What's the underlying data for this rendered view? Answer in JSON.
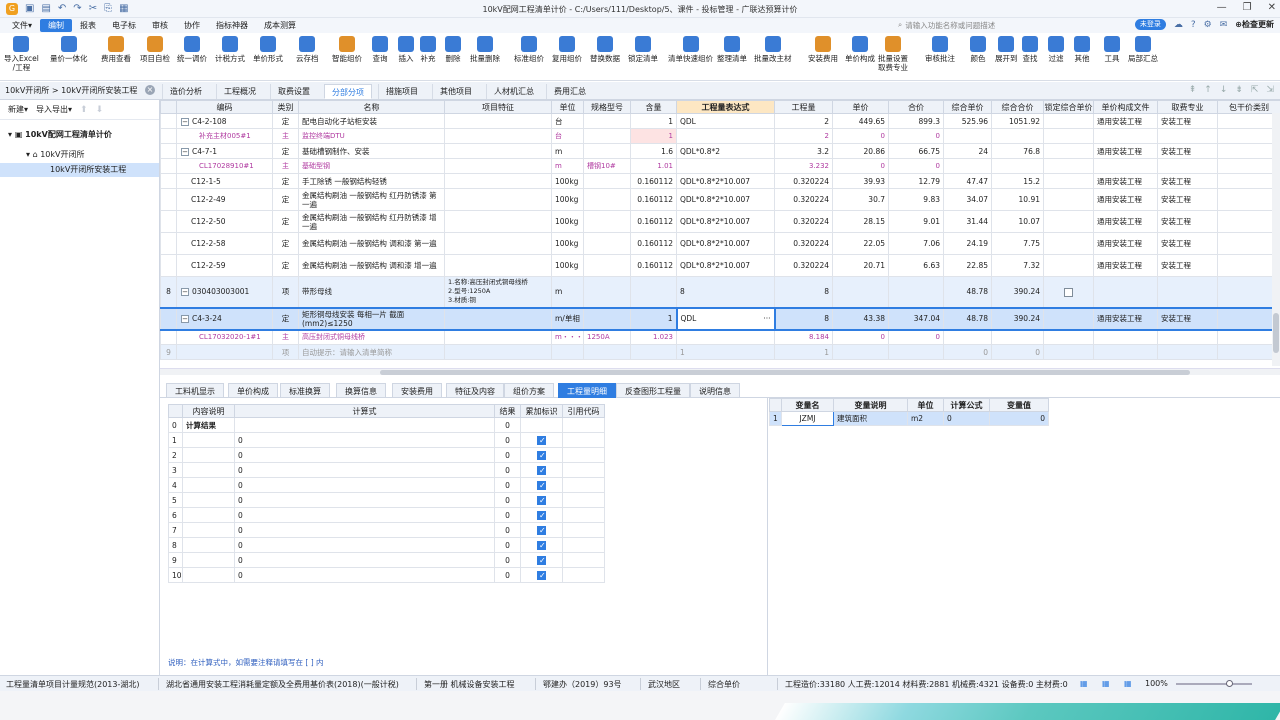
{
  "window": {
    "title": "10kV配网工程清单计价 - C:/Users/111/Desktop/5、课件 - 投标管理 - 广联达预算计价",
    "controls": [
      "—",
      "❐",
      "✕"
    ]
  },
  "menu": {
    "items": [
      "文件▾",
      "编制",
      "报表",
      "电子标",
      "审核",
      "协作",
      "指标神器",
      "成本测算"
    ],
    "active": 1,
    "search_placeholder": "请输入功能名称或问题描述",
    "login": "未登录",
    "update": "检查更新"
  },
  "ribbon": [
    {
      "label": "导入Excel\n/工程",
      "color": "#3a7bd5"
    },
    {
      "label": "量价一体化",
      "color": "#3a7bd5"
    },
    {
      "label": "费用查看",
      "color": "#e0902a"
    },
    {
      "label": "项目自检",
      "color": "#e0902a"
    },
    {
      "label": "统一调价",
      "color": "#3a7bd5"
    },
    {
      "label": "计税方式",
      "color": "#3a7bd5"
    },
    {
      "label": "单价形式",
      "color": "#3a7bd5"
    },
    {
      "label": "云存档",
      "color": "#3a7bd5"
    },
    {
      "label": "智能组价",
      "color": "#e0902a"
    },
    {
      "label": "查询",
      "color": "#3a7bd5"
    },
    {
      "label": "插入",
      "color": "#3a7bd5"
    },
    {
      "label": "补充",
      "color": "#3a7bd5"
    },
    {
      "label": "删除",
      "color": "#3a7bd5"
    },
    {
      "label": "批量删除",
      "color": "#3a7bd5"
    },
    {
      "label": "标准组价",
      "color": "#3a7bd5"
    },
    {
      "label": "复用组价",
      "color": "#3a7bd5"
    },
    {
      "label": "替换数据",
      "color": "#3a7bd5"
    },
    {
      "label": "锁定清单",
      "color": "#3a7bd5"
    },
    {
      "label": "清单快速组价",
      "color": "#3a7bd5"
    },
    {
      "label": "整理清单",
      "color": "#3a7bd5"
    },
    {
      "label": "批量改主材",
      "color": "#3a7bd5"
    },
    {
      "label": "安装费用",
      "color": "#e0902a"
    },
    {
      "label": "单价构成",
      "color": "#3a7bd5"
    },
    {
      "label": "批量设置\n取费专业",
      "color": "#e0902a"
    },
    {
      "label": "审核批注",
      "color": "#3a7bd5"
    },
    {
      "label": "颜色",
      "color": "#3a7bd5"
    },
    {
      "label": "展开到",
      "color": "#3a7bd5"
    },
    {
      "label": "查找",
      "color": "#3a7bd5"
    },
    {
      "label": "过滤",
      "color": "#3a7bd5"
    },
    {
      "label": "其他",
      "color": "#3a7bd5"
    },
    {
      "label": "工具",
      "color": "#3a7bd5"
    },
    {
      "label": "局部汇总",
      "color": "#3a7bd5"
    }
  ],
  "tabs": {
    "breadcrumb": "10kV开闭所 > 10kV开闭所安装工程",
    "items": [
      "造价分析",
      "工程概况",
      "取费设置",
      "分部分项",
      "措施项目",
      "其他项目",
      "人材机汇总",
      "费用汇总"
    ],
    "active": 3
  },
  "tree": {
    "toolbar": [
      "新建▾",
      "导入导出▾"
    ],
    "root": "10kV配网工程清单计价",
    "sub": "10kV开闭所",
    "selected": "10kV开闭所安装工程"
  },
  "grid": {
    "headers": [
      "",
      "编码",
      "类别",
      "名称",
      "项目特征",
      "单位",
      "规格型号",
      "含量",
      "工程量表达式",
      "工程量",
      "单价",
      "合价",
      "综合单价",
      "综合合价",
      "锁定综合单价",
      "单价构成文件",
      "取费专业",
      "包干价类别"
    ],
    "rows": [
      {
        "cls": "",
        "h": "",
        "tog": "−",
        "code": "C4-2-108",
        "type": "定",
        "name": "配电自动化子站柜安装",
        "feat": "",
        "unit": "台",
        "spec": "",
        "cont": "1",
        "expr": "QDL",
        "qty": "2",
        "price": "449.65",
        "total": "899.3",
        "uprice": "525.96",
        "utotal": "1051.92",
        "lock": "",
        "file": "通用安装工程",
        "prof": "安装工程"
      },
      {
        "cls": "mat",
        "h": "",
        "tog": "",
        "code": "补充主材005#1",
        "type": "主",
        "name": "监控终端DTU",
        "feat": "",
        "unit": "台",
        "spec": "",
        "cont": "1",
        "expr": "",
        "qty": "2",
        "price": "0",
        "total": "0",
        "uprice": "",
        "utotal": "",
        "lock": "",
        "file": "",
        "prof": ""
      },
      {
        "cls": "",
        "h": "",
        "tog": "−",
        "code": "C4-7-1",
        "type": "定",
        "name": "基础槽钢制作、安装",
        "feat": "",
        "unit": "m",
        "spec": "",
        "cont": "1.6",
        "expr": "QDL*0.8*2",
        "qty": "3.2",
        "price": "20.86",
        "total": "66.75",
        "uprice": "24",
        "utotal": "76.8",
        "lock": "",
        "file": "通用安装工程",
        "prof": "安装工程"
      },
      {
        "cls": "mat",
        "h": "",
        "tog": "",
        "code": "CL17028910#1",
        "type": "主",
        "name": "基础型钢",
        "feat": "",
        "unit": "m",
        "spec": "槽钢10#",
        "cont": "1.01",
        "expr": "",
        "qty": "3.232",
        "price": "0",
        "total": "0",
        "uprice": "",
        "utotal": "",
        "lock": "",
        "file": "",
        "prof": ""
      },
      {
        "cls": "",
        "h": "",
        "tog": "",
        "code": "C12-1-5",
        "type": "定",
        "name": "手工除锈 一般钢结构轻锈",
        "feat": "",
        "unit": "100kg",
        "spec": "",
        "cont": "0.160112",
        "expr": "QDL*0.8*2*10.007",
        "qty": "0.320224",
        "price": "39.93",
        "total": "12.79",
        "uprice": "47.47",
        "utotal": "15.2",
        "lock": "",
        "file": "通用安装工程",
        "prof": "安装工程"
      },
      {
        "cls": "t2",
        "h": "",
        "tog": "",
        "code": "C12-2-49",
        "type": "定",
        "name": "金属结构刷油 一般钢结构 红丹防锈漆 第一遍",
        "feat": "",
        "unit": "100kg",
        "spec": "",
        "cont": "0.160112",
        "expr": "QDL*0.8*2*10.007",
        "qty": "0.320224",
        "price": "30.7",
        "total": "9.83",
        "uprice": "34.07",
        "utotal": "10.91",
        "lock": "",
        "file": "通用安装工程",
        "prof": "安装工程"
      },
      {
        "cls": "t2",
        "h": "",
        "tog": "",
        "code": "C12-2-50",
        "type": "定",
        "name": "金属结构刷油 一般钢结构 红丹防锈漆 增一遍",
        "feat": "",
        "unit": "100kg",
        "spec": "",
        "cont": "0.160112",
        "expr": "QDL*0.8*2*10.007",
        "qty": "0.320224",
        "price": "28.15",
        "total": "9.01",
        "uprice": "31.44",
        "utotal": "10.07",
        "lock": "",
        "file": "通用安装工程",
        "prof": "安装工程"
      },
      {
        "cls": "t2",
        "h": "",
        "tog": "",
        "code": "C12-2-58",
        "type": "定",
        "name": "金属结构刷油 一般钢结构 调和漆 第一遍",
        "feat": "",
        "unit": "100kg",
        "spec": "",
        "cont": "0.160112",
        "expr": "QDL*0.8*2*10.007",
        "qty": "0.320224",
        "price": "22.05",
        "total": "7.06",
        "uprice": "24.19",
        "utotal": "7.75",
        "lock": "",
        "file": "通用安装工程",
        "prof": "安装工程"
      },
      {
        "cls": "t2",
        "h": "",
        "tog": "",
        "code": "C12-2-59",
        "type": "定",
        "name": "金属结构刷油 一般钢结构 调和漆 增一遍",
        "feat": "",
        "unit": "100kg",
        "spec": "",
        "cont": "0.160112",
        "expr": "QDL*0.8*2*10.007",
        "qty": "0.320224",
        "price": "20.71",
        "total": "6.63",
        "uprice": "22.85",
        "utotal": "7.32",
        "lock": "",
        "file": "通用安装工程",
        "prof": "安装工程"
      },
      {
        "cls": "t3 qd",
        "h": "8",
        "tog": "−",
        "code": "030403003001",
        "type": "项",
        "name": "带形母线",
        "feat": "1.名称:高压封闭式铜母线桥\n2.型号:1250A\n3.材质:铜",
        "unit": "m",
        "spec": "",
        "cont": "",
        "expr": "8",
        "qty": "8",
        "price": "",
        "total": "",
        "uprice": "48.78",
        "utotal": "390.24",
        "lock": "box",
        "file": "",
        "prof": ""
      },
      {
        "cls": "t2 sel",
        "h": "",
        "tog": "−",
        "code": "C4-3-24",
        "type": "定",
        "name": "矩形铜母线安装 每相一片 截面(mm2)≤1250",
        "feat": "",
        "unit": "m/单相",
        "spec": "",
        "cont": "1",
        "expr": "QDL",
        "qty": "8",
        "price": "43.38",
        "total": "347.04",
        "uprice": "48.78",
        "utotal": "390.24",
        "lock": "",
        "file": "通用安装工程",
        "prof": "安装工程"
      },
      {
        "cls": "mat",
        "h": "",
        "tog": "",
        "code": "CL17032020-1#1",
        "type": "主",
        "name": "高压封闭式铜母线桥",
        "feat": "",
        "unit": "m・・・",
        "spec": "1250A",
        "cont": "1.023",
        "expr": "",
        "qty": "8.184",
        "price": "0",
        "total": "0",
        "uprice": "",
        "utotal": "",
        "lock": "",
        "file": "",
        "prof": ""
      },
      {
        "cls": "auto",
        "h": "9",
        "tog": "",
        "code": "",
        "type": "项",
        "name": "自动提示：请输入清单简称",
        "feat": "",
        "unit": "",
        "spec": "",
        "cont": "",
        "expr": "1",
        "qty": "1",
        "price": "",
        "total": "",
        "uprice": "0",
        "utotal": "0",
        "lock": "",
        "file": "",
        "prof": ""
      }
    ]
  },
  "bottom_tabs": {
    "items": [
      "工料机显示",
      "单价构成",
      "标准换算",
      "换算信息",
      "安装费用",
      "特征及内容",
      "组价方案",
      "工程量明细",
      "反查图形工程量",
      "说明信息"
    ],
    "active": 7
  },
  "calc": {
    "headers": [
      "",
      "内容说明",
      "计算式",
      "结果",
      "累加标识",
      "引用代码"
    ],
    "rows": [
      {
        "i": "0",
        "desc": "计算结果",
        "formula": "",
        "result": "0",
        "check": false
      },
      {
        "i": "1",
        "desc": "",
        "formula": "0",
        "result": "0",
        "check": true
      },
      {
        "i": "2",
        "desc": "",
        "formula": "0",
        "result": "0",
        "check": true
      },
      {
        "i": "3",
        "desc": "",
        "formula": "0",
        "result": "0",
        "check": true
      },
      {
        "i": "4",
        "desc": "",
        "formula": "0",
        "result": "0",
        "check": true
      },
      {
        "i": "5",
        "desc": "",
        "formula": "0",
        "result": "0",
        "check": true
      },
      {
        "i": "6",
        "desc": "",
        "formula": "0",
        "result": "0",
        "check": true
      },
      {
        "i": "7",
        "desc": "",
        "formula": "0",
        "result": "0",
        "check": true
      },
      {
        "i": "8",
        "desc": "",
        "formula": "0",
        "result": "0",
        "check": true
      },
      {
        "i": "9",
        "desc": "",
        "formula": "0",
        "result": "0",
        "check": true
      },
      {
        "i": "10",
        "desc": "",
        "formula": "0",
        "result": "0",
        "check": true
      }
    ],
    "note": "说明：在计算式中，如需要注释请填写在 [ ] 内"
  },
  "variables": {
    "headers": [
      "",
      "变量名",
      "变量说明",
      "单位",
      "计算公式",
      "变量值"
    ],
    "rows": [
      {
        "i": "1",
        "name": "JZMJ",
        "desc": "建筑面积",
        "unit": "m2",
        "formula": "0",
        "value": "0"
      }
    ]
  },
  "status": {
    "items": [
      "工程量清单项目计量规范(2013-湖北)",
      "湖北省通用安装工程消耗量定额及全费用基价表(2018)(一般计税)",
      "第一册 机械设备安装工程",
      "鄂建办（2019）93号",
      "武汉地区",
      "综合单价",
      "工程造价:33180  人工费:12014  材料费:2881  机械费:4321  设备费:0  主材费:0"
    ],
    "zoom": "100%"
  }
}
